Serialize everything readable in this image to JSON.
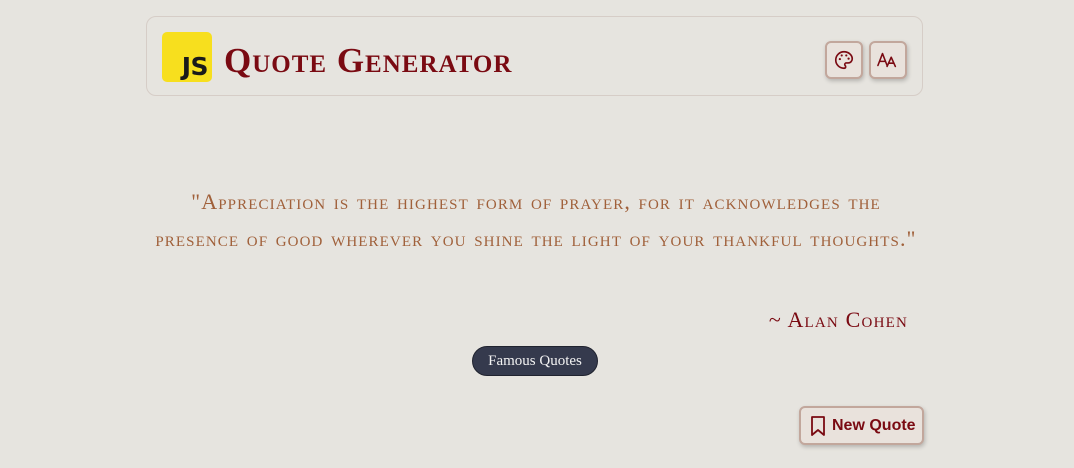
{
  "header": {
    "logo_text": "JS",
    "title": "Quote Generator"
  },
  "quote": {
    "text": "\"Appreciation is the highest form of prayer, for it acknowledges the presence of good wherever you shine the light of your thankful thoughts.\"",
    "author": "~ Alan Cohen",
    "tag": "Famous Quotes"
  },
  "actions": {
    "new_quote_label": "New Quote",
    "theme_icon": "palette-icon",
    "font_icon": "font-size-icon",
    "new_quote_icon": "bookmark-icon"
  },
  "colors": {
    "background": "#e6e4df",
    "title": "#7a0a12",
    "quote_text": "#a0603a",
    "tag_background": "#353a4d",
    "logo_background": "#f7df1e"
  }
}
